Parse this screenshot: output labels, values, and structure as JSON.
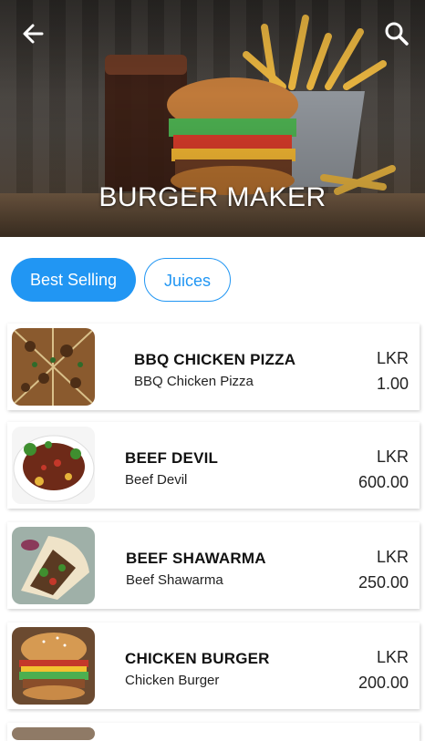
{
  "header": {
    "title": "BURGER MAKER",
    "back_icon": "arrow-left-icon",
    "search_icon": "search-icon"
  },
  "tabs": [
    {
      "label": "Best Selling",
      "active": true
    },
    {
      "label": "Juices",
      "active": false
    }
  ],
  "colors": {
    "accent": "#2196f3"
  },
  "items": [
    {
      "name": "BBQ CHICKEN PIZZA",
      "subtitle": "BBQ Chicken Pizza",
      "currency": "LKR",
      "price": "1.00"
    },
    {
      "name": "BEEF DEVIL",
      "subtitle": "Beef Devil",
      "currency": "LKR",
      "price": "600.00"
    },
    {
      "name": "BEEF SHAWARMA",
      "subtitle": "Beef Shawarma",
      "currency": "LKR",
      "price": "250.00"
    },
    {
      "name": "CHICKEN BURGER",
      "subtitle": "Chicken Burger",
      "currency": "LKR",
      "price": "200.00"
    }
  ]
}
